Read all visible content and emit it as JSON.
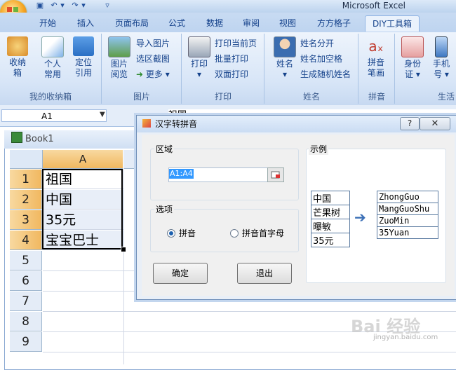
{
  "window": {
    "app_title": "Microsoft Excel"
  },
  "tabs": [
    "开始",
    "插入",
    "页面布局",
    "公式",
    "数据",
    "审阅",
    "视图",
    "方方格子",
    "DIY工具箱"
  ],
  "ribbon": {
    "groups": [
      {
        "label": "我的收纳箱",
        "big": [
          "收纳箱",
          "个人常用",
          "定位引用"
        ]
      },
      {
        "label": "图片",
        "big": [
          "图片阅览"
        ],
        "small": [
          "导入图片",
          "选区截图",
          "更多"
        ]
      },
      {
        "label": "打印",
        "big": [
          "打印"
        ],
        "small": [
          "打印当前页",
          "批量打印",
          "双面打印"
        ]
      },
      {
        "label": "姓名",
        "big": [
          "姓名"
        ],
        "small": [
          "姓名分开",
          "姓名加空格",
          "生成随机姓名"
        ]
      },
      {
        "label": "拼音",
        "big": [
          "拼音笔画"
        ]
      },
      {
        "label": "生活",
        "big": [
          "身份证",
          "手机号"
        ]
      }
    ],
    "big_labels": {
      "storage_1": "收纳",
      "storage_2": "箱",
      "personal_1": "个人",
      "personal_2": "常用",
      "locate_1": "定位",
      "locate_2": "引用",
      "picview_1": "图片",
      "picview_2": "阅览",
      "print": "打印",
      "name": "姓名",
      "pinyin_1": "拼音",
      "pinyin_2": "笔画",
      "idcard_1": "身份",
      "idcard_2": "证",
      "phone_1": "手机",
      "phone_2": "号"
    },
    "group_labels": {
      "storage": "我的收纳箱",
      "picture": "图片",
      "print": "打印",
      "name": "姓名",
      "pinyin": "拼音",
      "life": "生活"
    },
    "small_labels": {
      "import_pic": "导入图片",
      "screenshot": "选区截图",
      "more": "更多",
      "print_current": "打印当前页",
      "batch_print": "批量打印",
      "duplex_print": "双面打印",
      "split_name": "姓名分开",
      "name_space": "姓名加空格",
      "random_name": "生成随机姓名"
    }
  },
  "formula_bar": {
    "name_box": "A1",
    "content": "祖国"
  },
  "workbook": {
    "title": "Book1",
    "column_header": "A",
    "rows": [
      "1",
      "2",
      "3",
      "4",
      "5",
      "6",
      "7",
      "8",
      "9"
    ],
    "cells": [
      "祖国",
      "中国",
      "35元",
      "宝宝巴士"
    ]
  },
  "dialog": {
    "title": "汉字转拼音",
    "range_label": "区域",
    "range_value": "A1:A4",
    "options_label": "选项",
    "opt_pinyin": "拼音",
    "opt_initials": "拼音首字母",
    "selected_option": "拼音",
    "ok": "确定",
    "exit": "退出",
    "example_label": "示例",
    "example_input": [
      "中国",
      "芒果树",
      "曝敏",
      "35元"
    ],
    "example_output": [
      "ZhongGuo",
      "MangGuoShu",
      "ZuoMin",
      "35Yuan"
    ]
  },
  "watermark": {
    "text": "Bai 经验",
    "sub": "jingyan.baidu.com"
  },
  "colors": {
    "selection": "#f1b860",
    "ribbon": "#d7e5f7",
    "accent": "#1b5fae"
  }
}
